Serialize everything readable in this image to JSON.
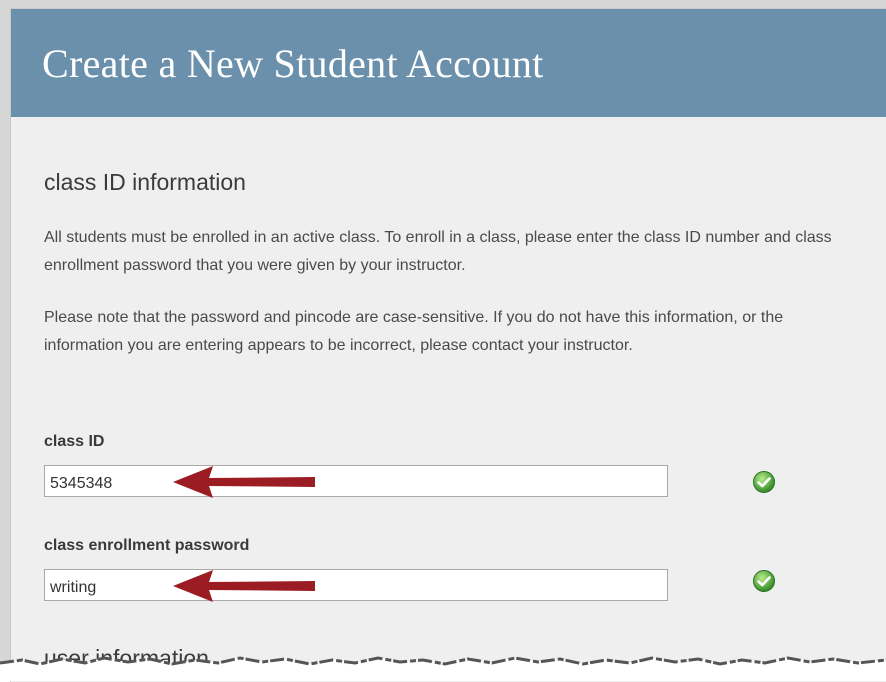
{
  "header": {
    "title": "Create a New Student Account"
  },
  "class_section": {
    "title": "class ID information",
    "intro": "All students must be enrolled in an active class. To enroll in a class, please enter the class ID number and class enrollment password that you were given by your instructor.",
    "note": "Please note that the password and pincode are case-sensitive. If you do not have this information, or the information you are entering appears to be incorrect, please contact your instructor.",
    "class_id": {
      "label": "class ID",
      "value": "5345348",
      "status_icon": "check-circle-icon"
    },
    "enrollment_password": {
      "label": "class enrollment password",
      "value": "writing",
      "status_icon": "check-circle-icon"
    }
  },
  "user_section": {
    "title": "user information"
  },
  "colors": {
    "header_bg": "#6a90ab",
    "panel_bg": "#efefef",
    "arrow": "#9b1c22",
    "check": "#3c9a2e"
  }
}
